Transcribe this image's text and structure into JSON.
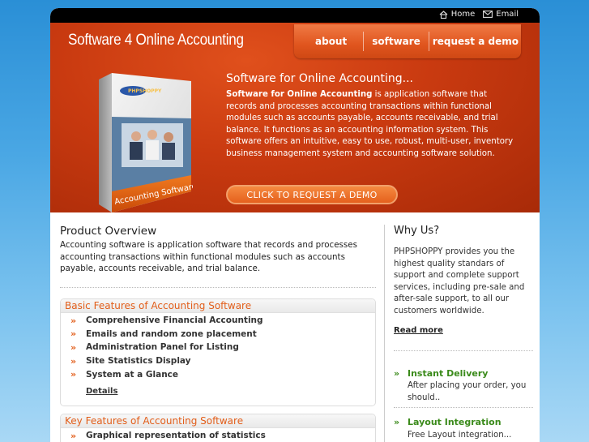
{
  "topbar": {
    "links": [
      {
        "label": "Home",
        "icon": "home-icon"
      },
      {
        "label": "Email",
        "icon": "envelope-icon"
      }
    ]
  },
  "header": {
    "brand": "Software 4 Online Accounting",
    "nav": [
      "about",
      "software",
      "request a demo"
    ],
    "product_box": {
      "logo": "PHPSHOPPY",
      "label": "Accounting Software"
    },
    "hero_title": "Software for Online Accounting...",
    "hero_text_bold": "Software for Online Accounting",
    "hero_text_rest": " is application software that records and processes accounting transactions within functional modules such as accounts payable, accounts receivable, and trial balance. It functions as an accounting information system. This software offers an intuitive, easy to use, robust, multi-user, inventory business management system and accounting software solution.",
    "cta_label": "CLICK TO REQUEST A DEMO"
  },
  "overview": {
    "title": "Product Overview",
    "text": "Accounting software is application software that records and processes accounting transactions within functional modules such as accounts payable, accounts receivable, and trial balance."
  },
  "basic_features": {
    "title": "Basic Features of Accounting Software",
    "items": [
      "Comprehensive Financial Accounting",
      "Emails and random zone placement",
      "Administration Panel for Listing",
      "Site Statistics Display",
      "System at a Glance"
    ],
    "details_label": "Details"
  },
  "key_features": {
    "title": "Key Features of Accounting Software",
    "items": [
      "Graphical representation of statistics"
    ]
  },
  "why_us": {
    "title": "Why Us?",
    "text": "PHPSHOPPY provides you the highest quality standars of support and complete support services, including pre-sale and after-sale support, to all our customers worldwide.",
    "read_more": "Read more",
    "highlights": [
      {
        "title": "Instant Delivery",
        "text": "After placing your order, you should.."
      },
      {
        "title": "Layout Integration",
        "text": "Free Layout integration..."
      }
    ]
  },
  "colors": {
    "accent_orange": "#e25e1a",
    "header_red": "#c93a10",
    "green": "#3a8a1a",
    "sky": "#4aa7e4"
  }
}
